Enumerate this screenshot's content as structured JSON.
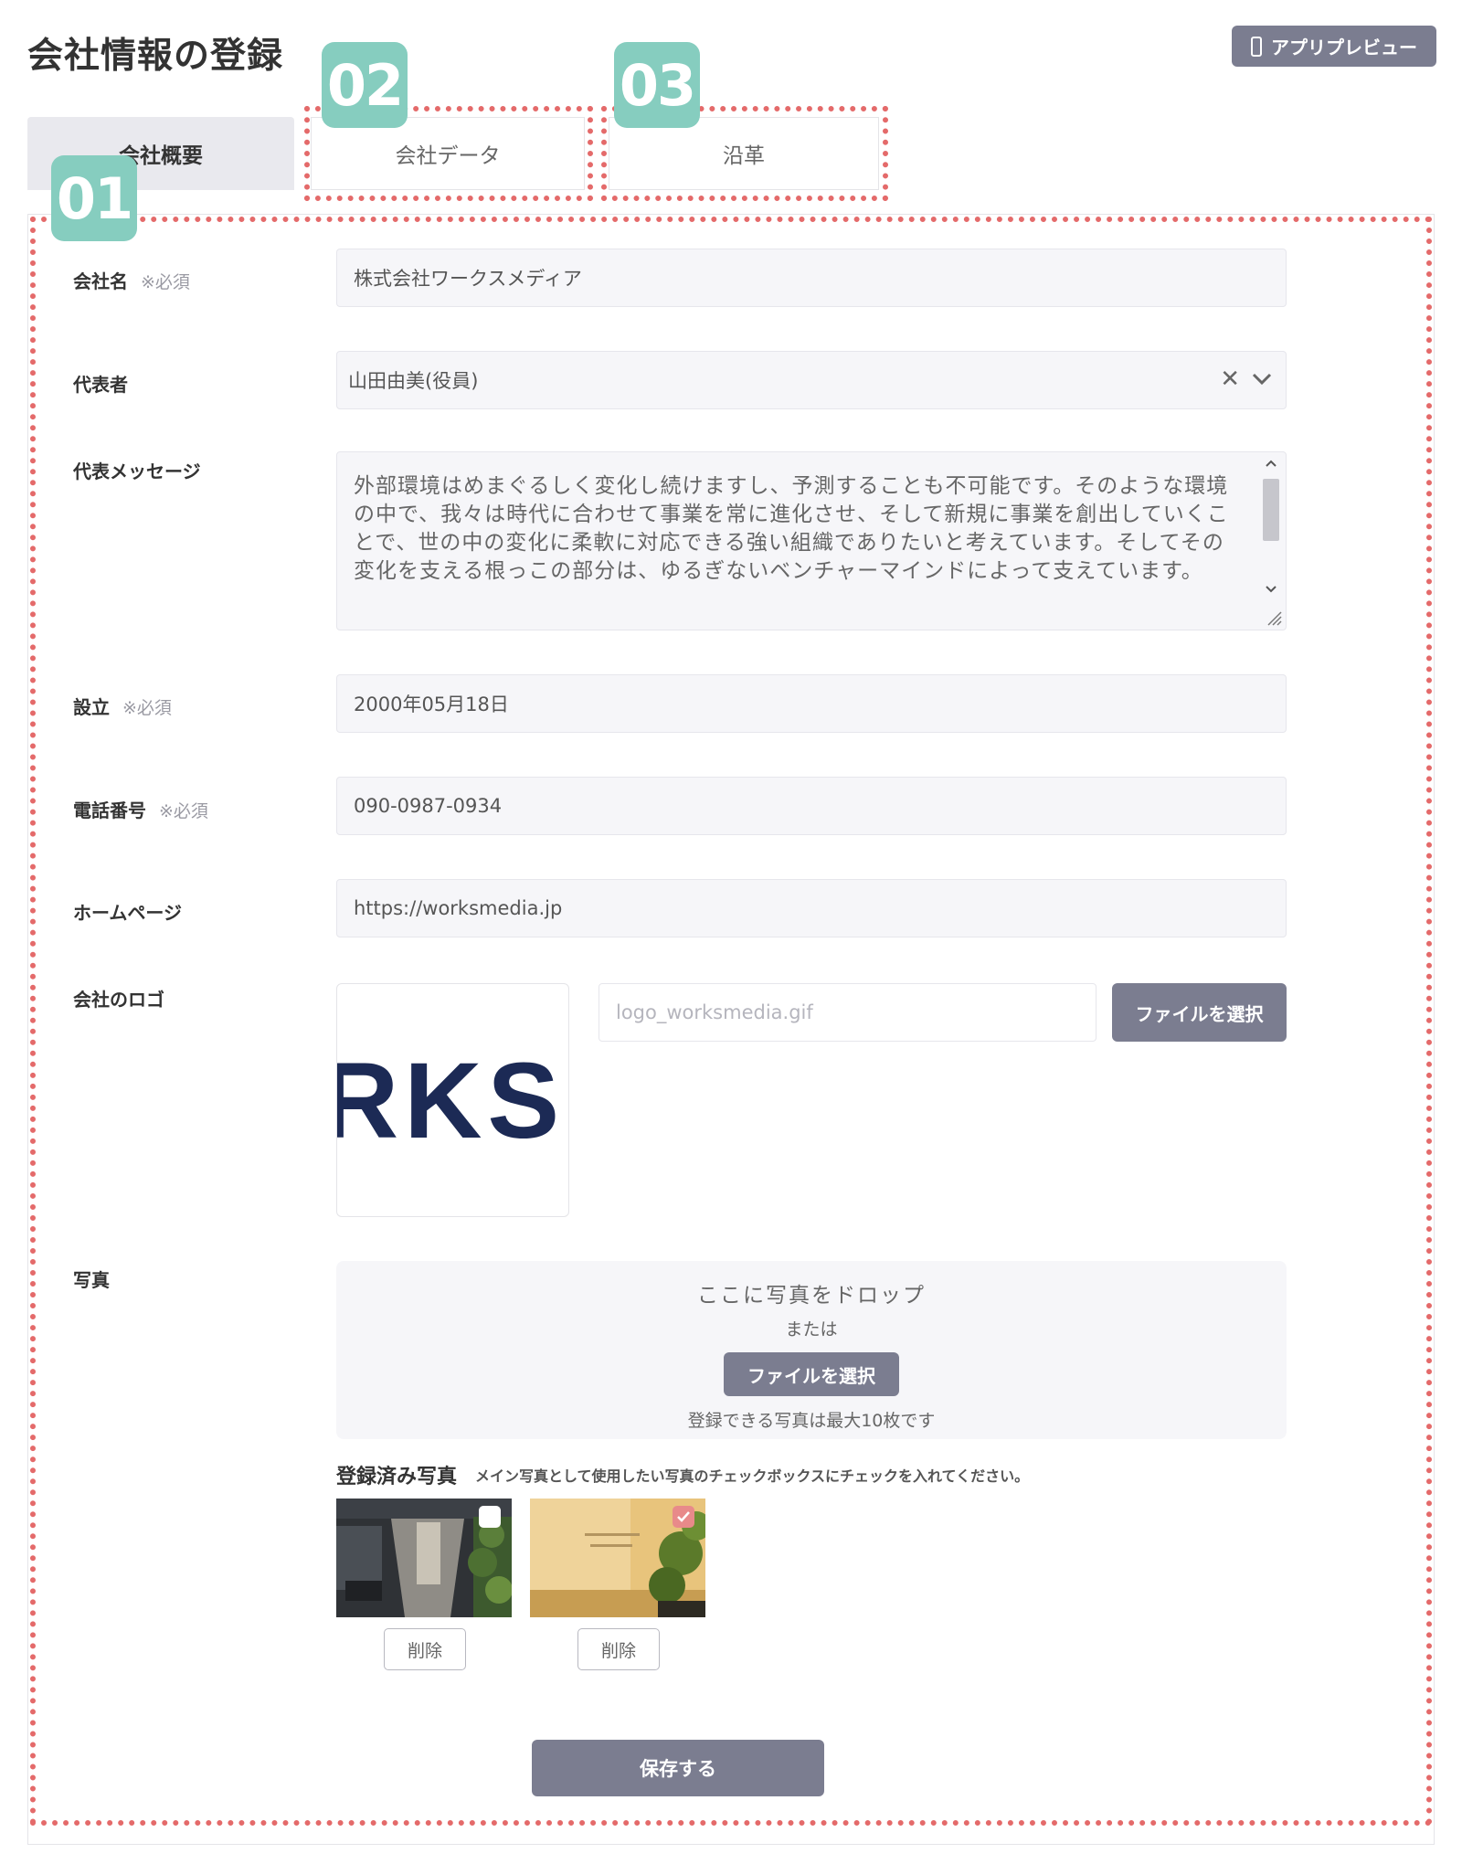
{
  "header": {
    "title": "会社情報の登録",
    "preview_button": "アプリプレビュー"
  },
  "tabs": [
    {
      "label": "会社概要",
      "active": true
    },
    {
      "label": "会社データ",
      "active": false
    },
    {
      "label": "沿革",
      "active": false
    }
  ],
  "badges": [
    "01",
    "02",
    "03"
  ],
  "form": {
    "company_name": {
      "label": "会社名",
      "required": "※必須",
      "value": "株式会社ワークスメディア"
    },
    "representative": {
      "label": "代表者",
      "value": "山田由美(役員)"
    },
    "message": {
      "label": "代表メッセージ",
      "value": "外部環境はめまぐるしく変化し続けますし、予測することも不可能です。そのような環境の中で、我々は時代に合わせて事業を常に進化させ、そして新規に事業を創出していくことで、世の中の変化に柔軟に対応できる強い組織でありたいと考えています。そしてその変化を支える根っこの部分は、ゆるぎないベンチャーマインドによって支えています。"
    },
    "founded": {
      "label": "設立",
      "required": "※必須",
      "value": "2000年05月18日"
    },
    "phone": {
      "label": "電話番号",
      "required": "※必須",
      "value": "090-0987-0934"
    },
    "homepage": {
      "label": "ホームページ",
      "value": "https://worksmedia.jp"
    },
    "logo": {
      "label": "会社のロゴ",
      "filename": "logo_worksmedia.gif",
      "choose_button": "ファイルを選択",
      "preview_text": "RKS"
    },
    "photos": {
      "label": "写真",
      "drop_text": "ここに写真をドロップ",
      "or_text": "または",
      "choose_button": "ファイルを選択",
      "limit_text": "登録できる写真は最大10枚です",
      "registered_title": "登録済み写真",
      "registered_hint": "メイン写真として使用したい写真のチェックボックスにチェックを入れてください。",
      "items": [
        {
          "delete_label": "削除",
          "checked": false
        },
        {
          "delete_label": "削除",
          "checked": true
        }
      ]
    },
    "save_button": "保存する"
  },
  "colors": {
    "accent_badge": "#86cdbf",
    "dotted_frame": "#e46a6a",
    "button": "#7b7d90"
  },
  "icons": [
    "phone-icon",
    "clear-icon",
    "chevron-down-icon",
    "scroll-up-icon",
    "scroll-down-icon",
    "resize-handle-icon",
    "checkbox-icon",
    "check-icon"
  ]
}
